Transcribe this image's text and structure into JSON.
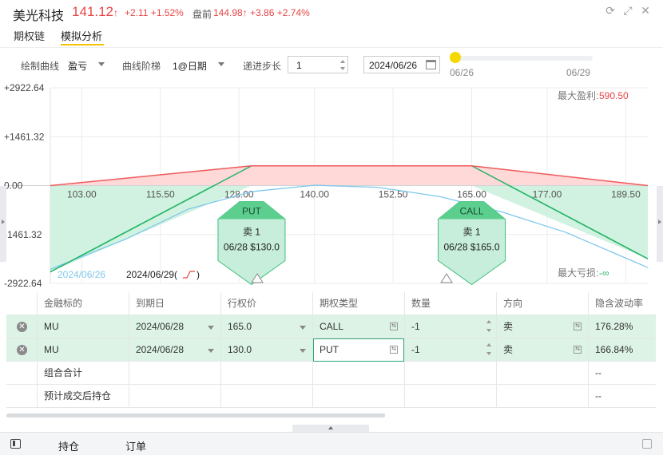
{
  "header": {
    "stock_name": "美光科技",
    "price": "141.12",
    "price_arrow": "↑",
    "change": "+2.11 +1.52%",
    "premarket_label": "盘前",
    "premarket": "144.98↑ +3.86 +2.74%"
  },
  "tabs": [
    {
      "label": "期权链",
      "active": false
    },
    {
      "label": "模拟分析",
      "active": true
    }
  ],
  "controls": {
    "curve_label": "绘制曲线",
    "curve_value": "盈亏",
    "step_label": "曲线阶梯",
    "step_value": "1@日期",
    "increment_label": "递进步长",
    "increment_value": "1",
    "date_value": "2024/06/26",
    "slider_start": "06/26",
    "slider_end": "06/29",
    "slider_position": 0
  },
  "chart_data": {
    "type": "line",
    "y_ticks": [
      "+2922.64",
      "+1461.32",
      "0.00",
      "-1461.32",
      "-2922.64"
    ],
    "y_values": [
      2922.64,
      1461.32,
      0,
      -1461.32,
      -2922.64
    ],
    "x_ticks": [
      "103.00",
      "115.50",
      "128.00",
      "140.00",
      "152.50",
      "165.00",
      "177.00",
      "189.50"
    ],
    "x_values": [
      103,
      115.5,
      128,
      140,
      152.5,
      165,
      177,
      189.5
    ],
    "xlim": [
      98,
      193
    ],
    "ylim": [
      -2922.64,
      2922.64
    ],
    "max_profit_label": "最大盈利:",
    "max_profit": "590.50",
    "max_loss_label": "最大亏损:",
    "max_loss": "-∞",
    "series": [
      {
        "name": "2024/06/29",
        "color": "#27b56a",
        "x": [
          98,
          130,
          165,
          193
        ],
        "y": [
          -2579.5,
          590.5,
          590.5,
          -2189.5
        ]
      },
      {
        "name": "2024/06/26",
        "color": "#7ec8ec",
        "x": [
          98,
          110,
          120,
          130,
          140,
          150,
          160,
          170,
          180,
          193
        ],
        "y": [
          -2500,
          -1600,
          -700,
          -180,
          10,
          -50,
          -330,
          -800,
          -1400,
          -2450
        ]
      }
    ],
    "legend": [
      {
        "label": "2024/06/26",
        "color": "#7ec8ec"
      },
      {
        "label": "2024/06/29",
        "color": "#222222"
      }
    ],
    "markers": [
      {
        "type": "PUT",
        "strike": 130,
        "action": "卖 1",
        "detail": "06/28 $130.0"
      },
      {
        "type": "CALL",
        "strike": 165,
        "action": "卖 1",
        "detail": "06/28 $165.0"
      }
    ],
    "price_markers": [
      130.9,
      161.0
    ]
  },
  "table": {
    "columns": [
      "金融标的",
      "到期日",
      "行权价",
      "期权类型",
      "数量",
      "方向",
      "隐含波动率"
    ],
    "rows": [
      {
        "underlying": "MU",
        "expiry": "2024/06/28",
        "strike": "165.0",
        "type": "CALL",
        "qty": "-1",
        "side": "卖",
        "iv": "176.28%"
      },
      {
        "underlying": "MU",
        "expiry": "2024/06/28",
        "strike": "130.0",
        "type": "PUT",
        "qty": "-1",
        "side": "卖",
        "iv": "166.84%"
      }
    ],
    "summary_label": "组合合计",
    "summary_iv": "--",
    "after_label": "预计成交后持仓",
    "after_iv": "--"
  },
  "footer": {
    "tab1": "持仓",
    "tab2": "订单"
  }
}
